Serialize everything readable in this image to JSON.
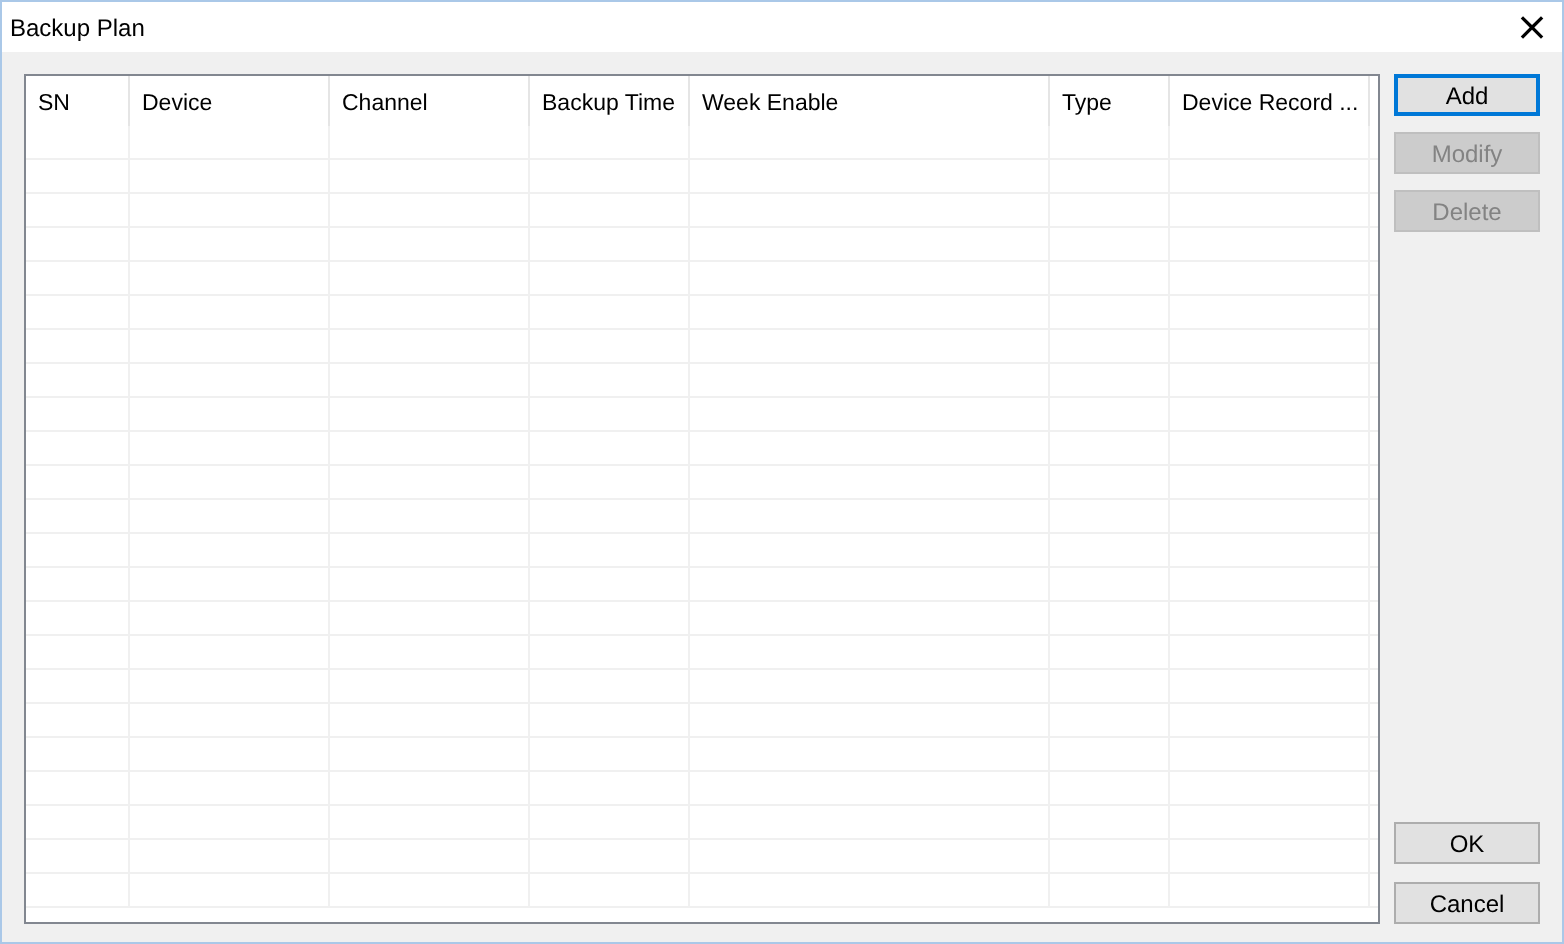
{
  "window": {
    "title": "Backup Plan",
    "close": "×"
  },
  "table": {
    "columns": [
      "SN",
      "Device",
      "Channel",
      "Backup Time",
      "Week Enable",
      "Type",
      "Device Record ..."
    ]
  },
  "side_buttons": [
    {
      "label": "Add",
      "disabled": false,
      "focused": true
    },
    {
      "label": "Modify",
      "disabled": true,
      "focused": false
    },
    {
      "label": "Delete",
      "disabled": true,
      "focused": false
    }
  ],
  "footer_buttons": [
    {
      "label": "OK",
      "disabled": false,
      "focused": false
    },
    {
      "label": "Cancel",
      "disabled": false,
      "focused": false
    }
  ]
}
